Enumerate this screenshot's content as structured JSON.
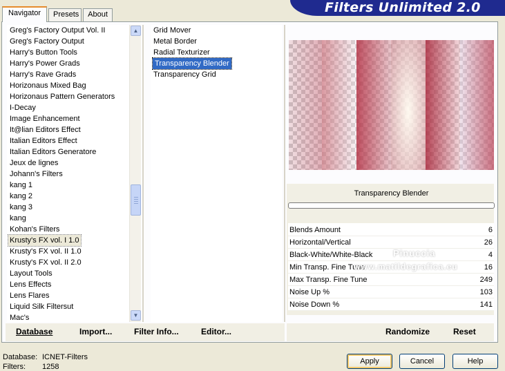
{
  "tabs": [
    {
      "label": "Navigator",
      "active": true
    },
    {
      "label": "Presets",
      "active": false
    },
    {
      "label": "About",
      "active": false
    }
  ],
  "banner": {
    "title": "Filters Unlimited 2.0"
  },
  "categories": [
    "Greg's Factory Output Vol. II",
    "Greg's Factory Output",
    "Harry's Button Tools",
    "Harry's Power Grads",
    "Harry's Rave Grads",
    "Horizonaus Mixed Bag",
    "Horizonaus Pattern Generators",
    "I-Decay",
    "Image Enhancement",
    "It@lian Editors Effect",
    "Italian Editors Effect",
    "Italian Editors Generatore",
    "Jeux de lignes",
    "Johann's Filters",
    "kang 1",
    "kang 2",
    "kang 3",
    "kang",
    "Kohan's Filters",
    "Krusty's FX vol. I 1.0",
    "Krusty's FX vol. II 1.0",
    "Krusty's FX vol. II 2.0",
    "Layout Tools",
    "Lens Effects",
    "Lens Flares",
    "Liquid Silk Filtersut",
    "Mac's"
  ],
  "selected_category": "Krusty's FX vol. I 1.0",
  "filters": [
    "Grid Mover",
    "Metal Border",
    "Radial Texturizer",
    "Transparency Blender",
    "Transparency Grid"
  ],
  "selected_filter": "Transparency Blender",
  "preview": {
    "filter_name": "Transparency Blender"
  },
  "params": [
    {
      "label": "Blends Amount",
      "value": "6"
    },
    {
      "label": "Horizontal/Vertical",
      "value": "26"
    },
    {
      "label": "Black-White/White-Black",
      "value": "4"
    },
    {
      "label": "Min Transp. Fine Tune",
      "value": "16"
    },
    {
      "label": "Max Transp. Fine Tune",
      "value": "249"
    },
    {
      "label": "Noise Up %",
      "value": "103"
    },
    {
      "label": "Noise Down %",
      "value": "141"
    }
  ],
  "watermark": {
    "line1": "Pinuccia",
    "line2": "www.matildegrafica.eu"
  },
  "toolbar": {
    "database": "Database",
    "import": "Import...",
    "filter_info": "Filter Info...",
    "editor": "Editor...",
    "randomize": "Randomize",
    "reset": "Reset"
  },
  "status": {
    "database_label": "Database:",
    "database_value": "ICNET-Filters",
    "filters_label": "Filters:",
    "filters_value": "1258"
  },
  "dialog_buttons": {
    "apply": "Apply",
    "cancel": "Cancel",
    "help": "Help"
  },
  "colors": {
    "banner": "#1f2a8f",
    "selection": "#316ac5",
    "tab_accent": "#e68b2c"
  }
}
